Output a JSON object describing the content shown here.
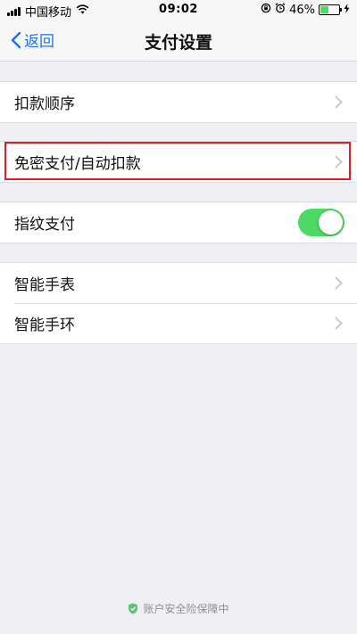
{
  "status_bar": {
    "carrier": "中国移动",
    "time": "09:02",
    "battery_percent": "46%",
    "battery_level": 0.46,
    "icons": [
      "signal-icon",
      "wifi-icon",
      "orientation-lock-icon",
      "alarm-icon",
      "battery-icon",
      "charging-bolt-icon"
    ]
  },
  "nav": {
    "back_label": "返回",
    "title": "支付设置"
  },
  "groups": {
    "g1": {
      "items": [
        {
          "label": "扣款顺序"
        }
      ]
    },
    "g2": {
      "items": [
        {
          "label": "免密支付/自动扣款",
          "highlighted": true
        }
      ]
    },
    "g3": {
      "items": [
        {
          "label": "指纹支付",
          "toggle_on": true
        }
      ]
    },
    "g4": {
      "items": [
        {
          "label": "智能手表"
        },
        {
          "label": "智能手环"
        }
      ]
    }
  },
  "footer": {
    "text": "账户安全险保障中",
    "icon": "shield-check-icon"
  },
  "colors": {
    "accent": "#1a73e8",
    "toggle_on": "#4cd964",
    "highlight": "#e02020",
    "background": "#efeff4"
  }
}
